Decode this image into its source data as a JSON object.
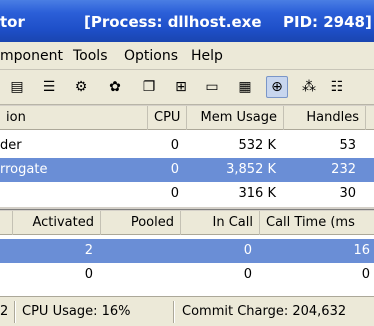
{
  "title": {
    "app": "tor",
    "process": "[Process: dllhost.exe",
    "pid": "PID: 2948]"
  },
  "menu": [
    "mponent",
    "Tools",
    "Options",
    "Help"
  ],
  "toolbar_icons": [
    "tree-icon",
    "properties-icon",
    "gear-icon",
    "settings-icon",
    "copy-icon",
    "tree-view-icon",
    "memory-icon",
    "window-icon",
    "cpu-icon",
    "stack-icon",
    "list-icon"
  ],
  "top_table": {
    "headers": [
      "ion",
      "CPU",
      "Mem Usage",
      "Handles"
    ],
    "rows": [
      {
        "name": "der",
        "cpu": "0",
        "mem": "532 K",
        "handles": "53"
      },
      {
        "name": "rrogate",
        "cpu": "0",
        "mem": "3,852 K",
        "handles": "232"
      },
      {
        "name": "",
        "cpu": "0",
        "mem": "316 K",
        "handles": "30"
      }
    ]
  },
  "bottom_table": {
    "headers": [
      "",
      "Activated",
      "Pooled",
      "In Call",
      "Call Time (ms"
    ],
    "rows": [
      {
        "activated": "2",
        "pooled": "",
        "incall": "0",
        "calltime": "16"
      },
      {
        "activated": "0",
        "pooled": "",
        "incall": "0",
        "calltime": "0"
      }
    ]
  },
  "status": {
    "left": "2",
    "cpu": "CPU Usage: 16%",
    "commit": "Commit Charge: 204,632"
  }
}
